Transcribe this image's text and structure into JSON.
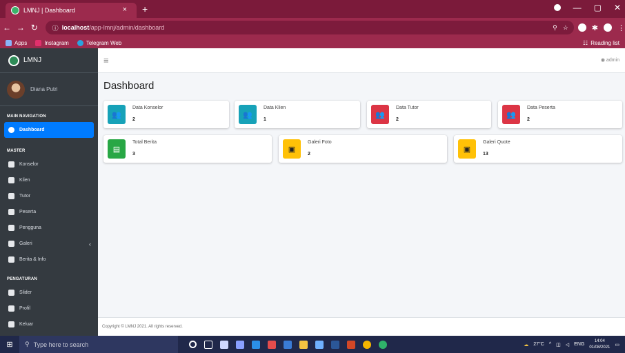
{
  "browser": {
    "tab_title": "LMNJ | Dashboard",
    "tab_close": "×",
    "new_tab": "+",
    "url_host": "localhost",
    "url_path": "/app-lmnj/admin/dashboard",
    "bookmarks": [
      {
        "label": "Apps",
        "color": "#8ab4f8"
      },
      {
        "label": "Instagram",
        "color": "#e1306c"
      },
      {
        "label": "Telegram Web",
        "color": "#2aa3de"
      }
    ],
    "reading_list": "Reading list"
  },
  "sidebar": {
    "brand": "LMNJ",
    "user_name": "Diana Putri",
    "sections": {
      "main": "MAIN NAVIGATION",
      "master": "MASTER",
      "pengaturan": "PENGATURAN"
    },
    "items": [
      {
        "label": "Dashboard",
        "icon": "dashboard-icon",
        "active": true
      },
      {
        "label": "Konselor",
        "icon": "user-icon"
      },
      {
        "label": "Klien",
        "icon": "user-icon"
      },
      {
        "label": "Tutor",
        "icon": "user-icon"
      },
      {
        "label": "Peserta",
        "icon": "user-icon"
      },
      {
        "label": "Pengguna",
        "icon": "user-icon"
      },
      {
        "label": "Galeri",
        "icon": "image-icon",
        "has_children": true
      },
      {
        "label": "Berita & Info",
        "icon": "news-icon"
      },
      {
        "label": "Slider",
        "icon": "image-icon"
      },
      {
        "label": "Profil",
        "icon": "building-icon"
      },
      {
        "label": "Keluar",
        "icon": "sign-out-icon"
      }
    ]
  },
  "topnav": {
    "menu_icon": "≡",
    "admin_label": "admin"
  },
  "main": {
    "page_title": "Dashboard",
    "row1": [
      {
        "label": "Data Konselor",
        "value": "2",
        "color": "#17a2b8",
        "icon": "users-icon"
      },
      {
        "label": "Data Klien",
        "value": "1",
        "color": "#17a2b8",
        "icon": "users-icon"
      },
      {
        "label": "Data Tutor",
        "value": "2",
        "color": "#dc3545",
        "icon": "users-icon"
      },
      {
        "label": "Data Peserta",
        "value": "2",
        "color": "#dc3545",
        "icon": "users-icon"
      }
    ],
    "row2": [
      {
        "label": "Total Berita",
        "value": "3",
        "color": "#28a745",
        "icon": "newspaper-icon"
      },
      {
        "label": "Galeri Foto",
        "value": "2",
        "color": "#ffc107",
        "icon": "image-icon"
      },
      {
        "label": "Galeri Quote",
        "value": "13",
        "color": "#ffc107",
        "icon": "image-icon"
      }
    ]
  },
  "footer": {
    "text": "Copyright © LMNJ 2021. All rights reserved."
  },
  "taskbar": {
    "search_placeholder": "Type here to search",
    "weather": "27°C",
    "lang": "ENG",
    "time": "14:04",
    "date": "01/08/2021"
  }
}
